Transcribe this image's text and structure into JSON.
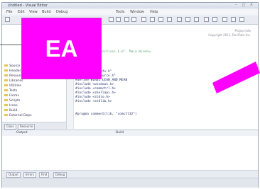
{
  "badge": {
    "label": "EA",
    "color": "#ff00ff"
  },
  "window": {
    "title": "Untitled - Visual Editor",
    "controls": [
      "–",
      "□",
      "×"
    ]
  },
  "menu": [
    "File",
    "Edit",
    "View",
    "Build",
    "Debug",
    "Tools",
    "Window",
    "Help"
  ],
  "tree": {
    "items": [
      "Source Files",
      "Header Files",
      "Resource Files",
      "Libraries",
      "Utilities",
      "Tests",
      "Forms",
      "Scripts",
      "Icons",
      "Build",
      "External Deps"
    ]
  },
  "panel_tabs": [
    "Class",
    "Resource"
  ],
  "editor": {
    "note_lines": [
      "Project Info",
      "Copyright 2011, DevTools Inc."
    ],
    "lines": [
      "// Example \"Functions 6.0\", Main Window",
      "",
      "",
      "#include \"stdafx.h\"",
      "#include \"resource.h\"",
      "#define WIN32_LEAN_AND_MEAN",
      "#include <windows.h>",
      "#include <commctrl.h>",
      "#include <shellapi.h>",
      "#include <stdio.h>",
      "#include <stdlib.h>",
      "",
      "#pragma comment(lib, \"comctl32\")"
    ]
  },
  "bottom": {
    "header_left": "Output",
    "header_mid": "Build"
  },
  "bottom_tabs": [
    "Output",
    "Errors",
    "Find",
    "Debug"
  ],
  "colors": {
    "accent": "#ff00ff",
    "chrome": "#eef1f5"
  },
  "icons": [
    "folder-icon",
    "toolbar-button-icon",
    "minimize-icon",
    "maximize-icon",
    "close-icon"
  ]
}
